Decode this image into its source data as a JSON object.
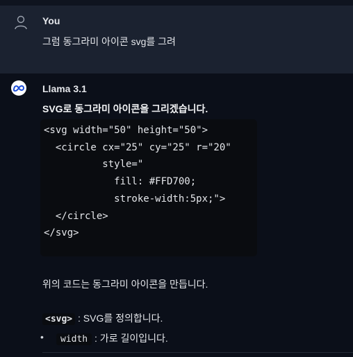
{
  "user_message": {
    "author": "You",
    "text": "그럼 동그라미 아이콘 svg를 그려",
    "icon": "user-icon"
  },
  "assistant_message": {
    "author": "Llama 3.1",
    "icon": "meta-logo-icon",
    "intro": "SVG로 동그라미 아이콘을 그리겠습니다.",
    "code_lines": [
      "<svg width=\"50\" height=\"50\">",
      "  <circle cx=\"25\" cy=\"25\" r=\"20\"",
      "          style=\"",
      "            fill: #FFD700;",
      "            stroke-width:5px;\">",
      "  </circle>",
      "</svg>"
    ],
    "paragraph": "위의 코드는 동그라미 아이콘을 만듭니다.",
    "definition": {
      "code": "<svg>",
      "text": ": SVG를 정의합니다."
    },
    "bullets": [
      {
        "code": "width",
        "text": ": 가로 길이입니다."
      }
    ]
  },
  "colors": {
    "background": "#0b0f19",
    "user_bubble": "#1b2230",
    "code_background": "#0a0c10",
    "text": "#e5e7eb"
  }
}
